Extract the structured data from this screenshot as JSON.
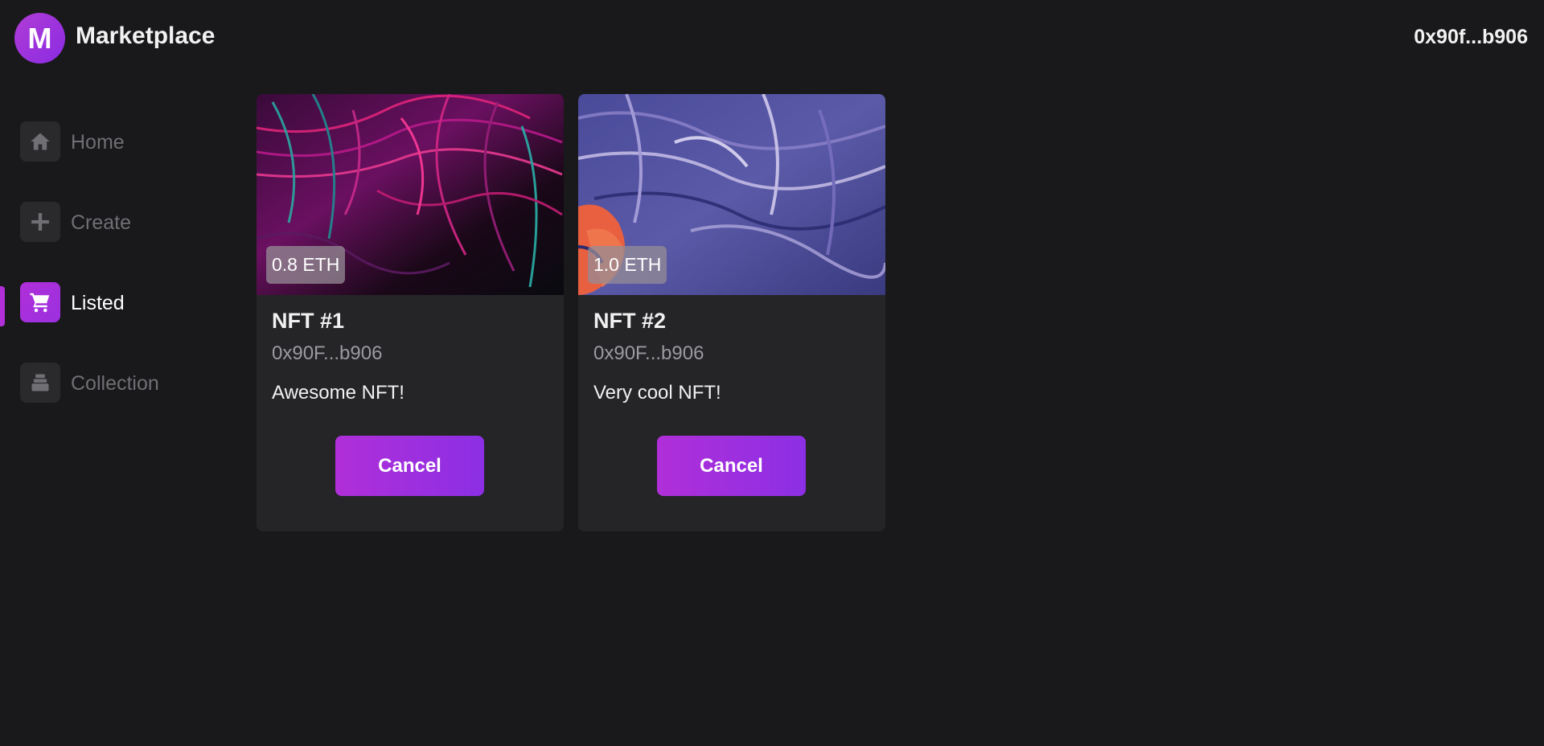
{
  "header": {
    "logo_letter": "M",
    "title": "Marketplace",
    "wallet_address": "0x90f...b906"
  },
  "sidebar": {
    "items": [
      {
        "label": "Home",
        "icon": "home-icon",
        "active": false
      },
      {
        "label": "Create",
        "icon": "plus-icon",
        "active": false
      },
      {
        "label": "Listed",
        "icon": "cart-icon",
        "active": true
      },
      {
        "label": "Collection",
        "icon": "stack-icon",
        "active": false
      }
    ]
  },
  "nfts": [
    {
      "name": "NFT #1",
      "owner": "0x90F...b906",
      "description": "Awesome NFT!",
      "price": "0.8 ETH",
      "button_label": "Cancel"
    },
    {
      "name": "NFT #2",
      "owner": "0x90F...b906",
      "description": "Very cool NFT!",
      "price": "1.0 ETH",
      "button_label": "Cancel"
    }
  ],
  "colors": {
    "background": "#19191b",
    "card": "#252528",
    "accent": "#b02fd8",
    "accent_end": "#8c2fe4",
    "muted_text": "#6f6f74"
  }
}
